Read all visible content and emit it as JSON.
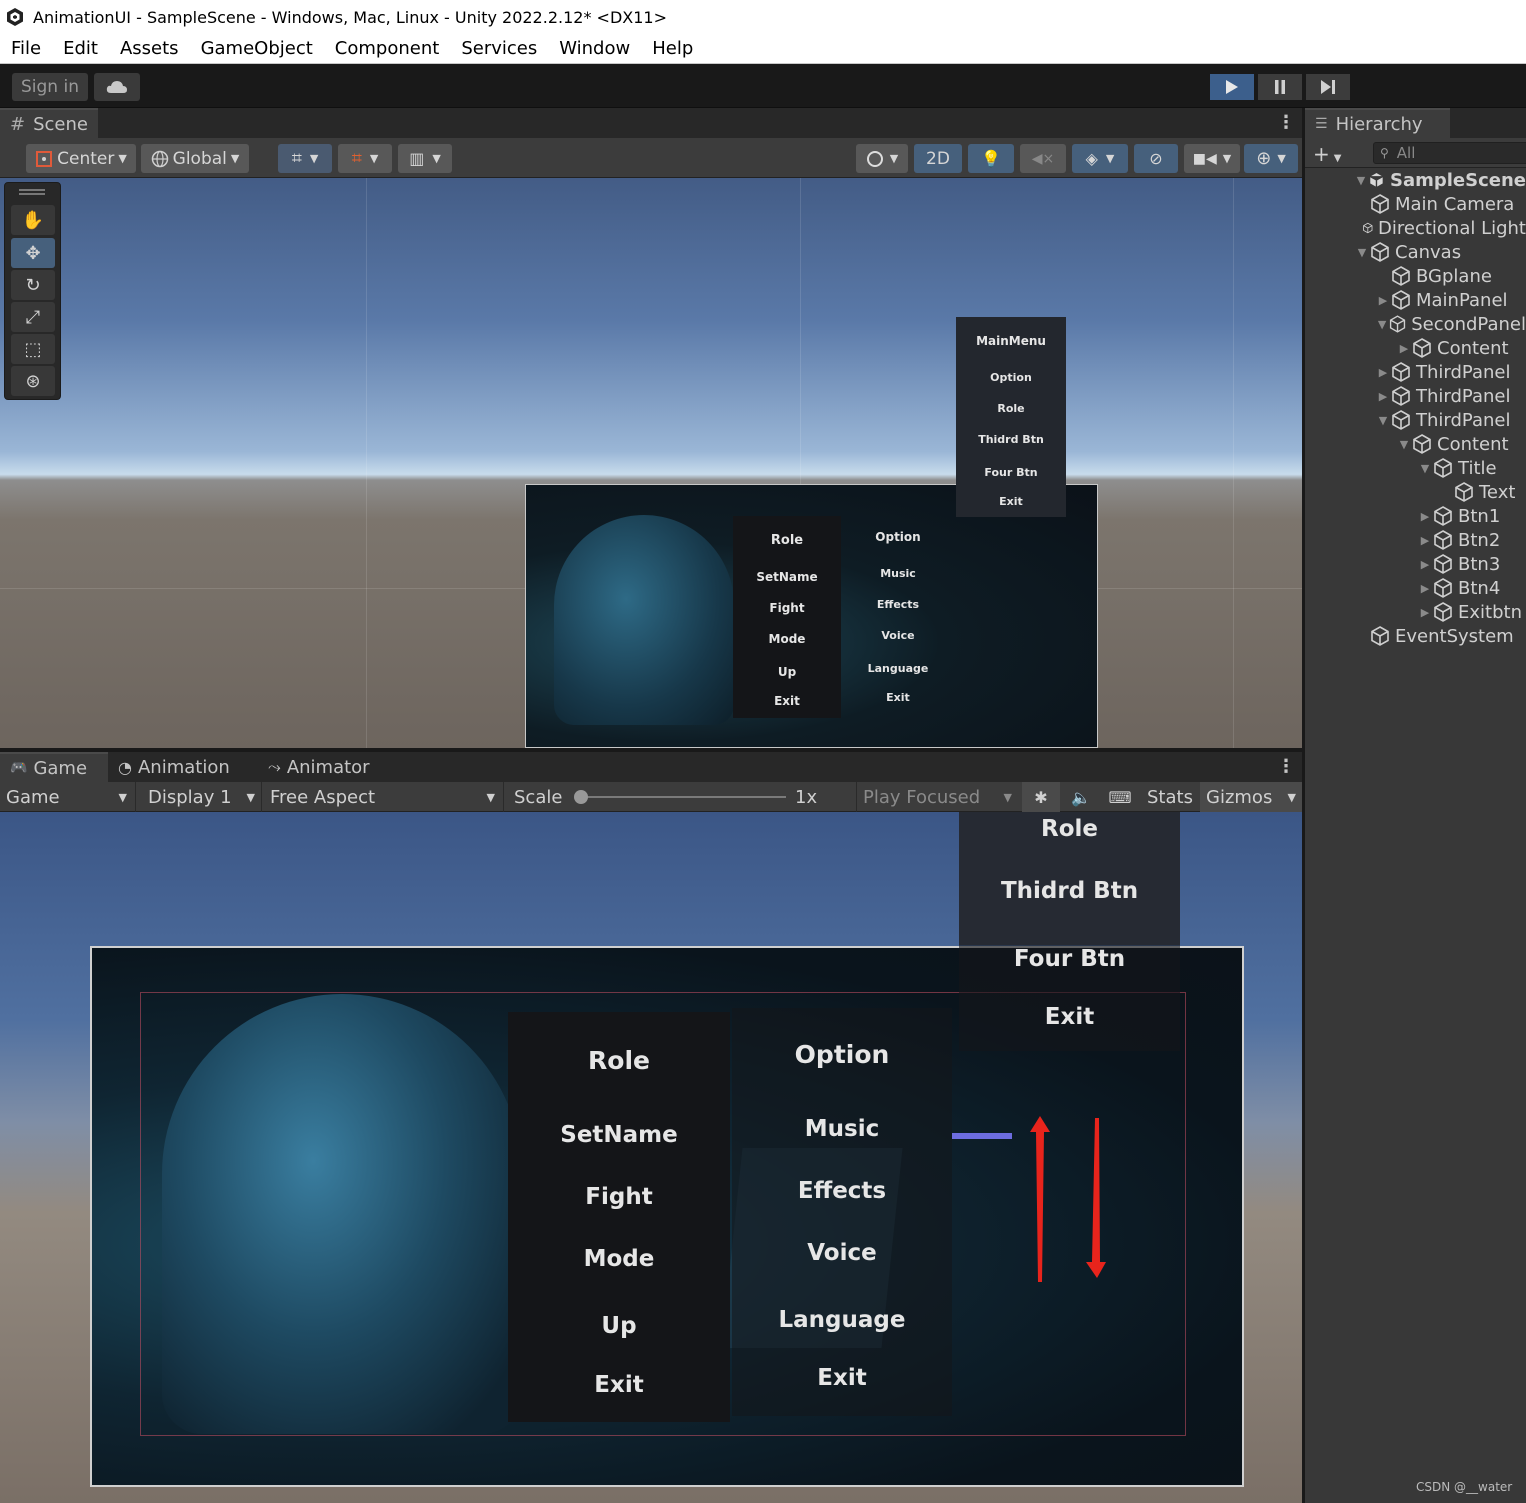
{
  "window": {
    "title": "AnimationUI - SampleScene - Windows, Mac, Linux - Unity 2022.2.12* <DX11>"
  },
  "menu": [
    "File",
    "Edit",
    "Assets",
    "GameObject",
    "Component",
    "Services",
    "Window",
    "Help"
  ],
  "toolbar": {
    "sign_in": "Sign in"
  },
  "scene": {
    "tab_label": "Scene",
    "pivot": "Center",
    "space": "Global",
    "mode_2d": "2D"
  },
  "scene_ui": {
    "menu": [
      "MainMenu",
      "Option",
      "Role",
      "Thidrd Btn",
      "Four Btn",
      "Exit"
    ],
    "role_panel": [
      "Role",
      "SetName",
      "Fight",
      "Mode",
      "Up",
      "Exit"
    ],
    "option_panel": [
      "Option",
      "Music",
      "Effects",
      "Voice",
      "Language",
      "Exit"
    ]
  },
  "hierarchy": {
    "tab_label": "Hierarchy",
    "search_placeholder": "All",
    "rows": [
      {
        "label": "SampleScene",
        "depth": 0,
        "expander": "open",
        "scene": true
      },
      {
        "label": "Main Camera",
        "depth": 1,
        "expander": "none"
      },
      {
        "label": "Directional Light",
        "depth": 1,
        "expander": "none"
      },
      {
        "label": "Canvas",
        "depth": 1,
        "expander": "open"
      },
      {
        "label": "BGplane",
        "depth": 2,
        "expander": "none"
      },
      {
        "label": "MainPanel",
        "depth": 2,
        "expander": "closed"
      },
      {
        "label": "SecondPanel",
        "depth": 2,
        "expander": "open"
      },
      {
        "label": "Content",
        "depth": 3,
        "expander": "closed"
      },
      {
        "label": "ThirdPanel",
        "depth": 2,
        "expander": "closed"
      },
      {
        "label": "ThirdPanel",
        "depth": 2,
        "expander": "closed"
      },
      {
        "label": "ThirdPanel",
        "depth": 2,
        "expander": "open"
      },
      {
        "label": "Content",
        "depth": 3,
        "expander": "open"
      },
      {
        "label": "Title",
        "depth": 4,
        "expander": "open"
      },
      {
        "label": "Text",
        "depth": 5,
        "expander": "none"
      },
      {
        "label": "Btn1",
        "depth": 4,
        "expander": "closed"
      },
      {
        "label": "Btn2",
        "depth": 4,
        "expander": "closed"
      },
      {
        "label": "Btn3",
        "depth": 4,
        "expander": "closed"
      },
      {
        "label": "Btn4",
        "depth": 4,
        "expander": "closed"
      },
      {
        "label": "Exitbtn",
        "depth": 4,
        "expander": "closed"
      },
      {
        "label": "EventSystem",
        "depth": 1,
        "expander": "none"
      }
    ]
  },
  "bottom_tabs": {
    "game": "Game",
    "animation": "Animation",
    "animator": "Animator"
  },
  "game_bar": {
    "view": "Game",
    "display": "Display 1",
    "aspect": "Free Aspect",
    "scale_label": "Scale",
    "scale_value": "1x",
    "play_mode": "Play Focused",
    "stats": "Stats",
    "gizmos": "Gizmos"
  },
  "game_ui": {
    "menu": [
      "Role",
      "Thidrd Btn",
      "Four Btn",
      "Exit"
    ],
    "role_panel": [
      "Role",
      "SetName",
      "Fight",
      "Mode",
      "Up",
      "Exit"
    ],
    "option_panel": [
      "Option",
      "Music",
      "Effects",
      "Voice",
      "Language",
      "Exit"
    ]
  },
  "watermark": "CSDN @__water",
  "colors": {
    "play_active": "#3c5f8c",
    "arrow_annotation": "#e8241c",
    "panel_bg": "#141518"
  }
}
